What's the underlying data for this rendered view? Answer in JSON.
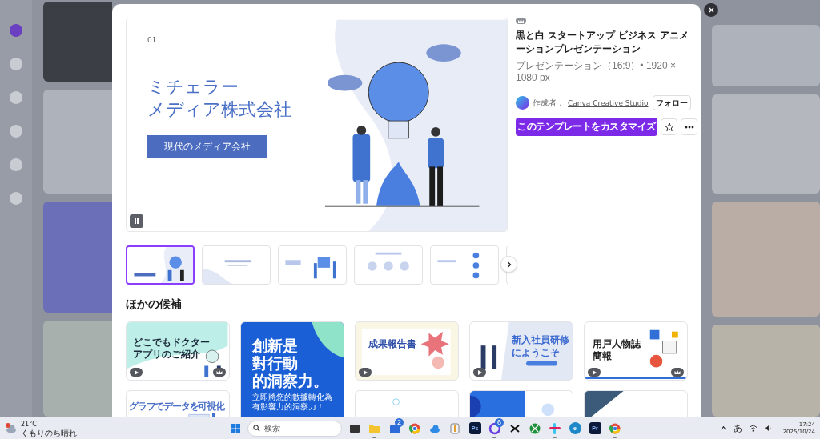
{
  "preview": {
    "slide_number": "01",
    "heading_lines": [
      "ミチェラー",
      "メディア株式会社"
    ],
    "tagline": "現代のメディア会社"
  },
  "info": {
    "title": "黒と白 スタートアップ ビジネス アニメーションプレゼンテーション",
    "subtitle": "プレゼンテーション（16:9）• 1920 × 1080 px",
    "author_label": "作成者：",
    "author_name": "Canva Creative Studio",
    "follow_button": "フォロー",
    "customize_button": "このテンプレートをカスタマイズ"
  },
  "thumbnails": [
    {
      "kind": "title",
      "selected": true
    },
    {
      "kind": "question",
      "selected": false
    },
    {
      "kind": "stat",
      "selected": false
    },
    {
      "kind": "values",
      "selected": false
    },
    {
      "kind": "list",
      "selected": false
    },
    {
      "kind": "blank",
      "selected": false
    }
  ],
  "section_title": "ほかの候補",
  "templates": [
    {
      "kind": "doctor",
      "lines": [
        "どこでもドクター",
        "アプリのご紹介"
      ],
      "video": true,
      "premium": true
    },
    {
      "kind": "quote",
      "lines": [
        "創新是",
        "對行動",
        "的洞察力。"
      ],
      "caption_lines": [
        "立即將您的數據轉化為",
        "有影響力的洞察力！"
      ]
    },
    {
      "kind": "report",
      "lines": [
        "成果報告書"
      ],
      "video": true,
      "premium": false
    },
    {
      "kind": "training",
      "lines": [
        "新入社員研修",
        "にようこそ"
      ],
      "video": true,
      "premium": false
    },
    {
      "kind": "persona",
      "lines": [
        "用戸人物誌",
        "簡報"
      ],
      "video": true,
      "premium": true
    },
    {
      "kind": "chart",
      "lines": [
        "グラフでデータを可視化"
      ]
    },
    {
      "kind": "plain"
    },
    {
      "kind": "blue-shapes"
    },
    {
      "kind": "dark-corner"
    }
  ],
  "taskbar": {
    "temperature": "21°C",
    "weather": "くもりのち晴れ",
    "search_placeholder": "検索",
    "apps": [
      {
        "kind": "task-view",
        "running": false
      },
      {
        "kind": "folder",
        "running": true
      },
      {
        "kind": "store",
        "badge": "2",
        "running": false
      },
      {
        "kind": "browser",
        "running": false
      },
      {
        "kind": "cloud",
        "running": false
      },
      {
        "kind": "tool",
        "running": false
      },
      {
        "kind": "lettered",
        "label": "Ps",
        "running": false
      },
      {
        "kind": "ring",
        "badge": "6",
        "running": true
      },
      {
        "kind": "cut",
        "running": false
      },
      {
        "kind": "game",
        "running": false
      },
      {
        "kind": "hash",
        "running": true
      },
      {
        "kind": "lettered-round",
        "label": "e",
        "running": false
      },
      {
        "kind": "lettered",
        "label": "Pr",
        "running": false
      },
      {
        "kind": "browser-badged",
        "running": true
      }
    ],
    "ime": "あ",
    "time": "17:24",
    "date": "2025/10/24"
  }
}
